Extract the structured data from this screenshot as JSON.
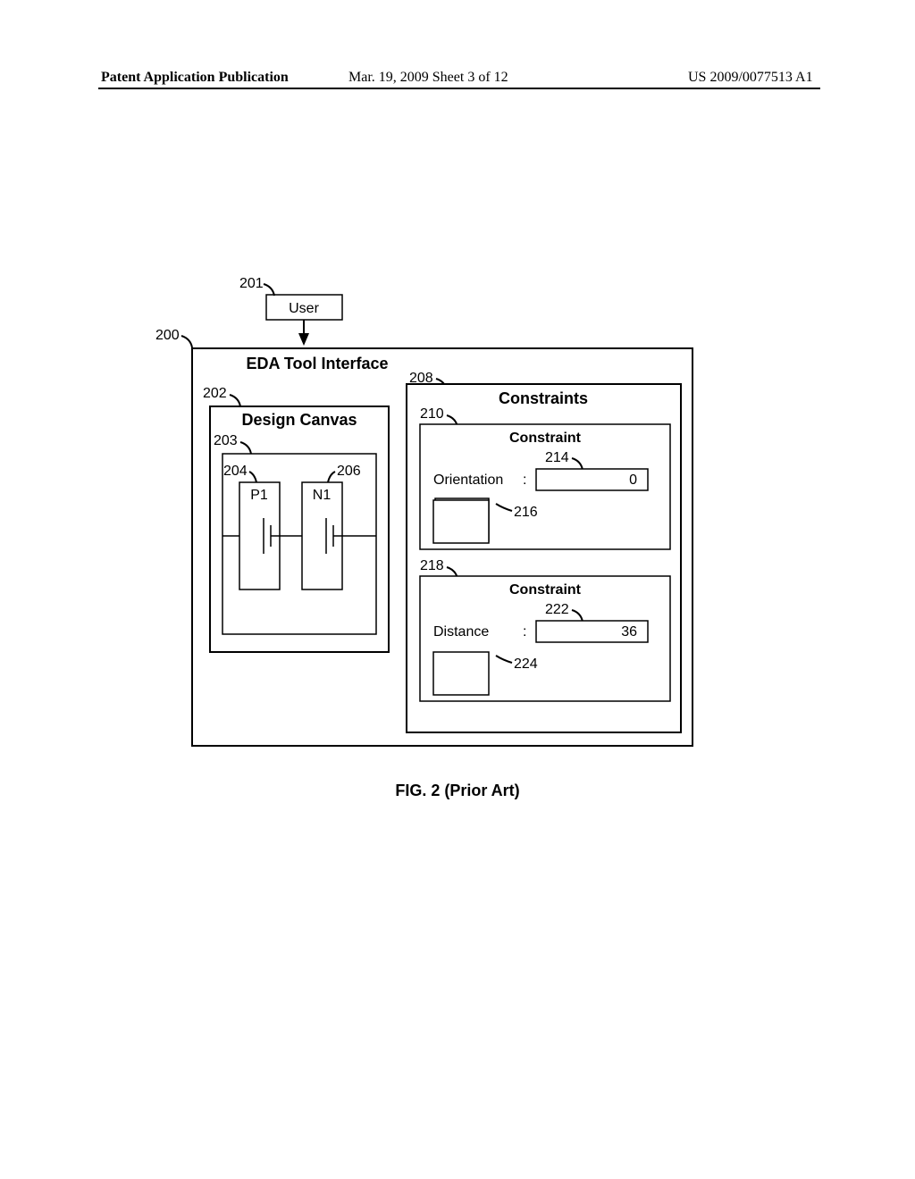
{
  "header": {
    "left": "Patent Application Publication",
    "mid": "Mar. 19, 2009  Sheet 3 of 12",
    "right": "US 2009/0077513 A1"
  },
  "caption": "FIG. 2 (Prior Art)",
  "refs": {
    "r200": "200",
    "r201": "201",
    "r202": "202",
    "r203": "203",
    "r204": "204",
    "r206": "206",
    "r208": "208",
    "r210": "210",
    "r214": "214",
    "r216": "216",
    "r218": "218",
    "r222": "222",
    "r224": "224"
  },
  "labels": {
    "user": "User",
    "eda": "EDA Tool Interface",
    "canvas": "Design Canvas",
    "constraints": "Constraints",
    "constraint": "Constraint",
    "orientation": "Orientation",
    "distance": "Distance",
    "p1": "P1",
    "n1": "N1",
    "colon": ":",
    "v_orient": "0",
    "v_dist": "36"
  }
}
